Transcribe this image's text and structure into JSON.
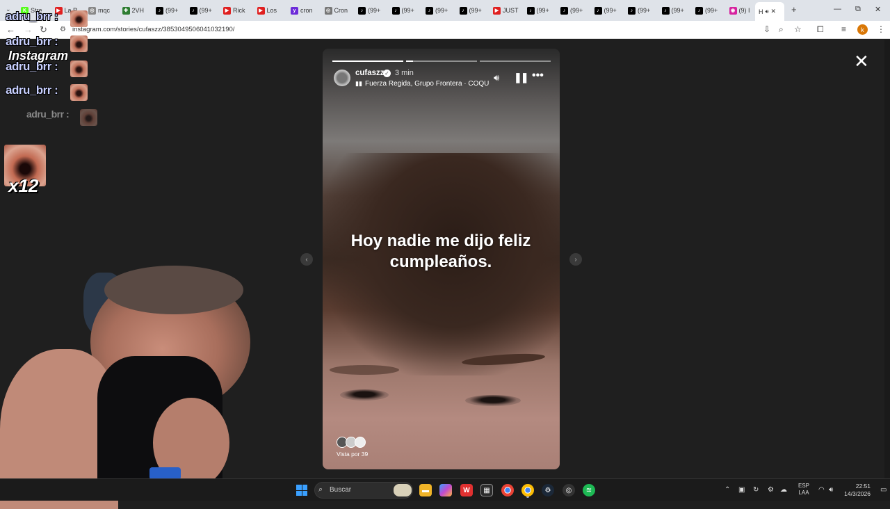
{
  "browser": {
    "tabs": [
      {
        "label": "Stre",
        "color": "#53fc18",
        "glyph": "K"
      },
      {
        "label": "La R",
        "color": "#e02020",
        "glyph": "▶"
      },
      {
        "label": "mqc",
        "color": "#888888",
        "glyph": "◎"
      },
      {
        "label": "2VH",
        "color": "#2e7d32",
        "glyph": "✚"
      },
      {
        "label": "(99+",
        "color": "#000000",
        "glyph": "♪"
      },
      {
        "label": "(99+",
        "color": "#000000",
        "glyph": "♪"
      },
      {
        "label": "Rick",
        "color": "#e02020",
        "glyph": "▶"
      },
      {
        "label": "Los",
        "color": "#e02020",
        "glyph": "▶"
      },
      {
        "label": "cron",
        "color": "#6c2bd9",
        "glyph": "y"
      },
      {
        "label": "Cron",
        "color": "#777777",
        "glyph": "◎"
      },
      {
        "label": "(99+",
        "color": "#000000",
        "glyph": "♪"
      },
      {
        "label": "(99+",
        "color": "#000000",
        "glyph": "♪"
      },
      {
        "label": "(99+",
        "color": "#000000",
        "glyph": "♪"
      },
      {
        "label": "(99+",
        "color": "#000000",
        "glyph": "♪"
      },
      {
        "label": "JUST",
        "color": "#e02020",
        "glyph": "▶"
      },
      {
        "label": "(99+",
        "color": "#000000",
        "glyph": "♪"
      },
      {
        "label": "(99+",
        "color": "#000000",
        "glyph": "♪"
      },
      {
        "label": "(99+",
        "color": "#000000",
        "glyph": "♪"
      },
      {
        "label": "(99+",
        "color": "#000000",
        "glyph": "♪"
      },
      {
        "label": "(99+",
        "color": "#000000",
        "glyph": "♪"
      },
      {
        "label": "(99+",
        "color": "#000000",
        "glyph": "♪"
      },
      {
        "label": "(9) I",
        "color": "#d6249f",
        "glyph": "◉"
      }
    ],
    "active_tab": {
      "label": "H"
    },
    "url": "instagram.com/stories/cufaszz/3853049506041032190/",
    "profile_initial": "k"
  },
  "story": {
    "username": "cufaszz",
    "time": "3 min",
    "music": "Fuerza Regida, Grupo Frontera · COQU",
    "caption": "Hoy nadie me dijo feliz cumpleaños.",
    "viewers": "Vista por 39",
    "progress": [
      1,
      0.1,
      0,
      0
    ]
  },
  "overlay": {
    "chat": [
      {
        "user": "adru_brr :",
        "faded": false
      },
      {
        "user": "adru_brr :",
        "faded": false
      },
      {
        "user": "adru_brr :",
        "faded": false
      },
      {
        "user": "adru_brr :",
        "faded": false
      },
      {
        "user": "adru_brr :",
        "faded": true
      }
    ],
    "instagram_text": "Instagram",
    "combo": "x12"
  },
  "taskbar": {
    "search_placeholder": "Buscar",
    "lang_top": "ESP",
    "lang_bottom": "LAA",
    "time": "22:51",
    "date": "14/3/2026"
  }
}
